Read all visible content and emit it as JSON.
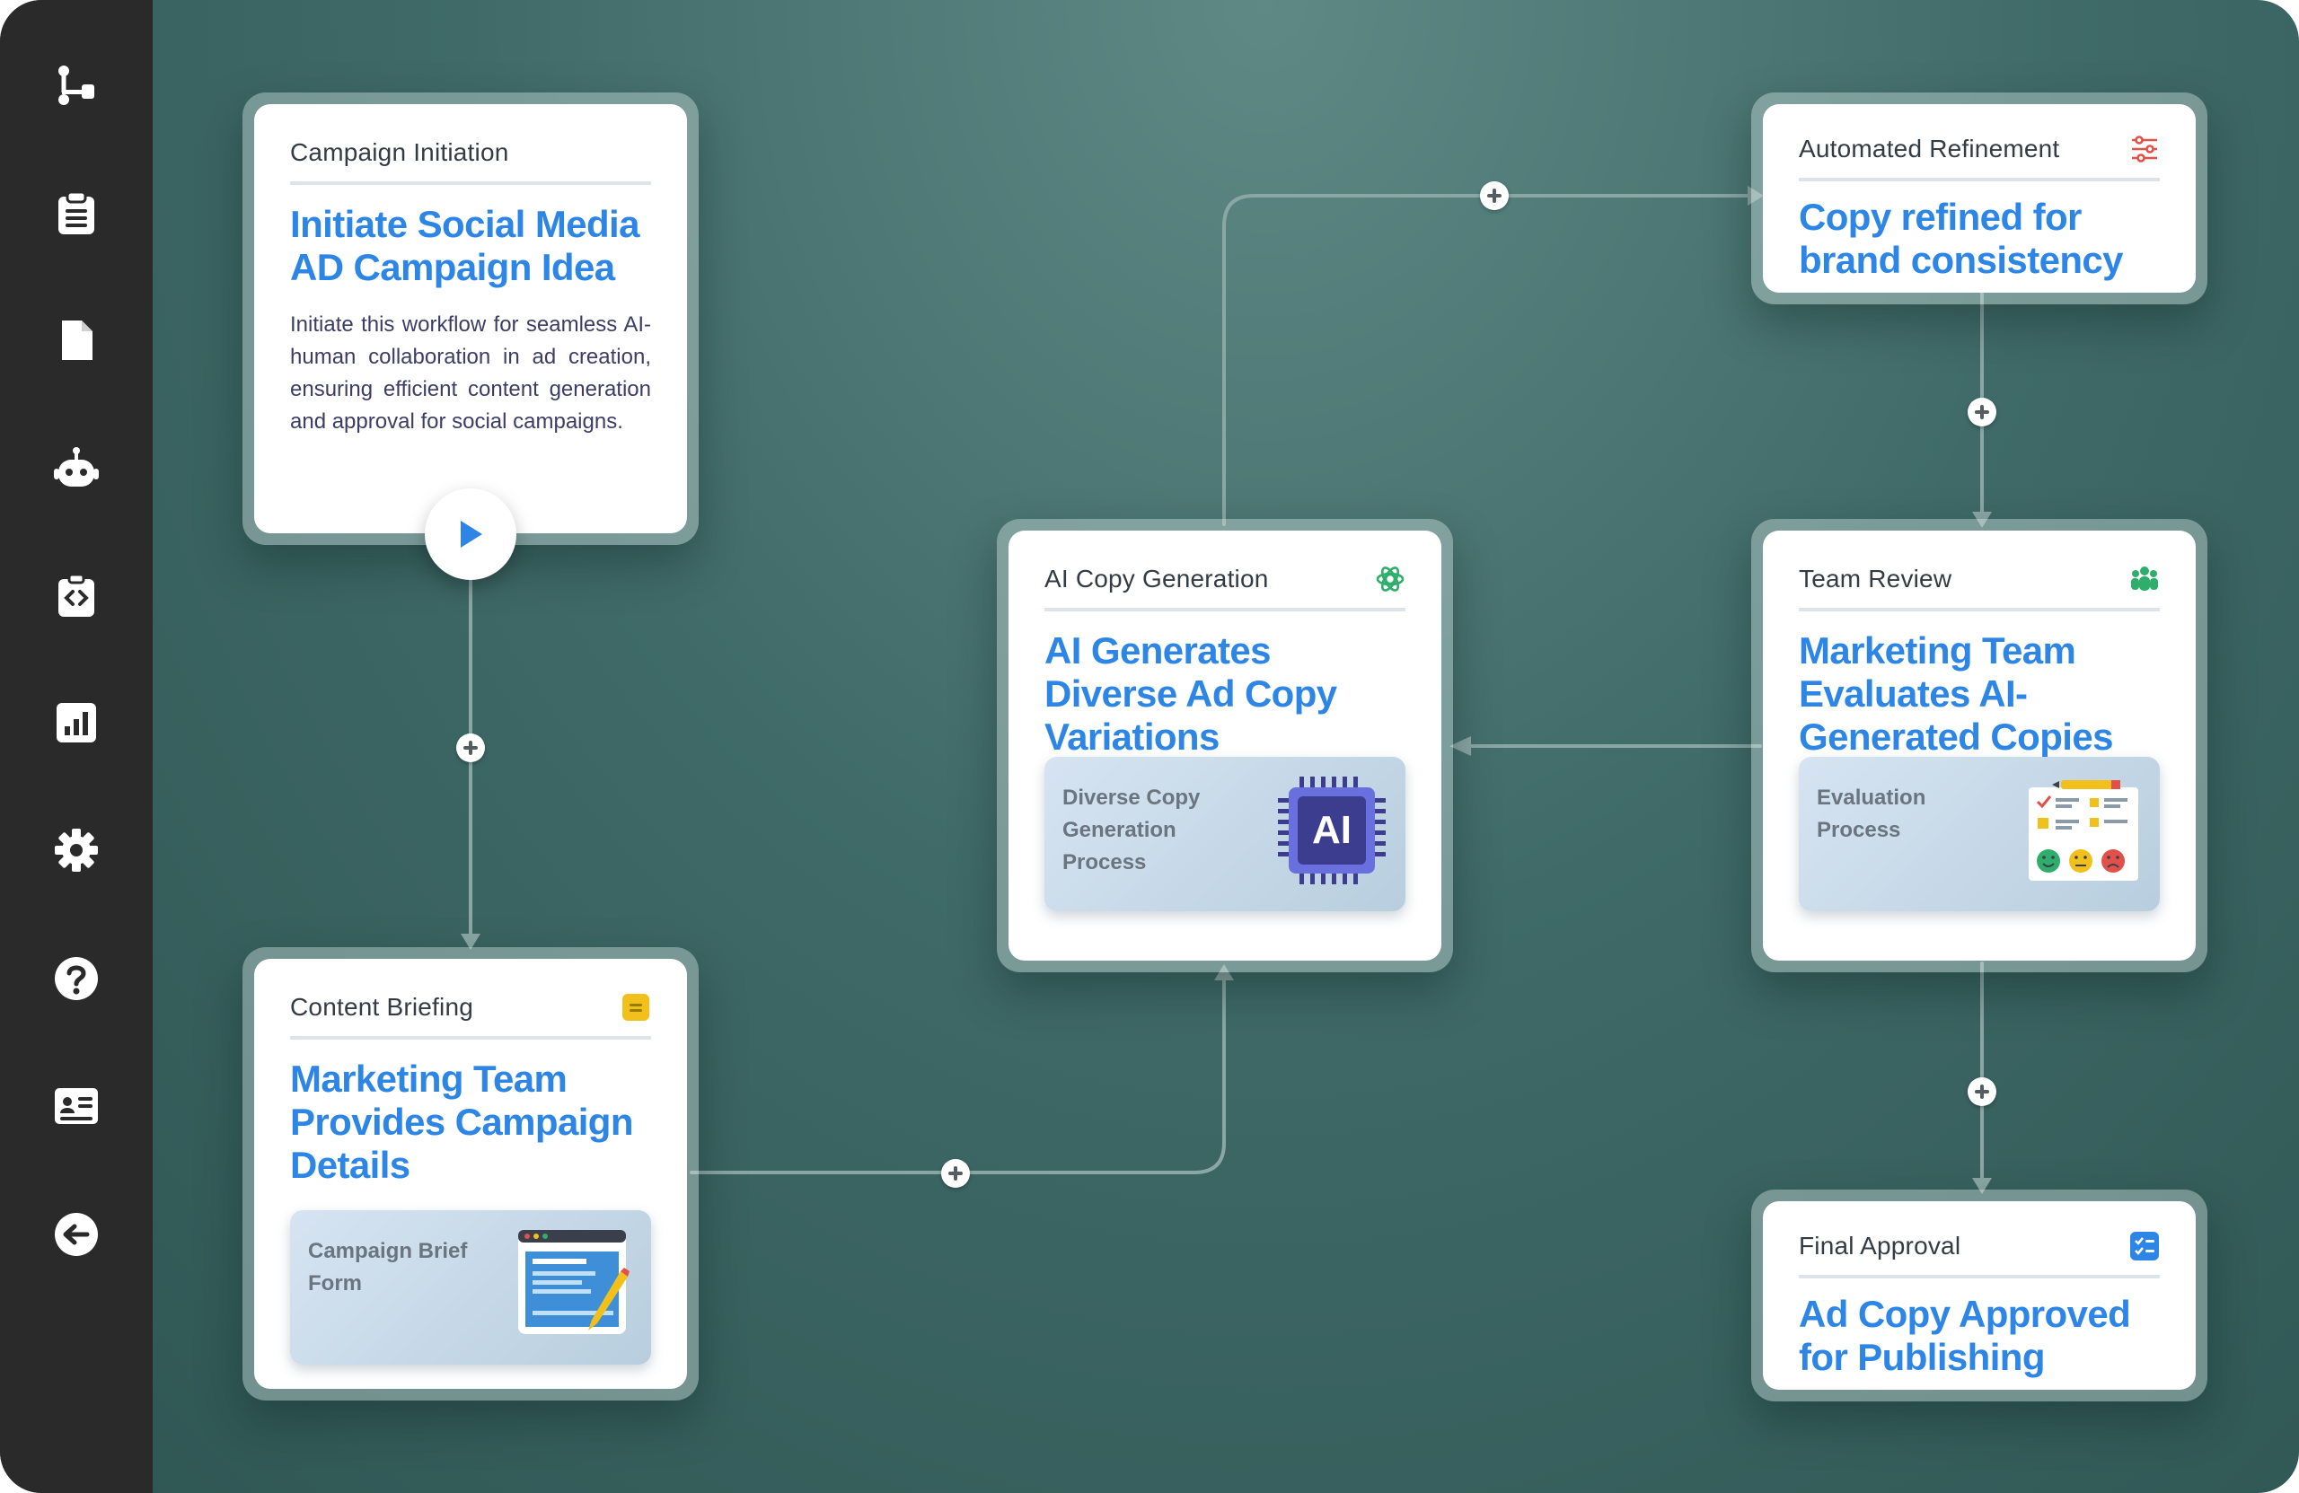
{
  "sidebar": {
    "icons": [
      {
        "name": "workflow-icon"
      },
      {
        "name": "clipboard-icon"
      },
      {
        "name": "document-icon"
      },
      {
        "name": "robot-icon"
      },
      {
        "name": "code-clipboard-icon"
      },
      {
        "name": "analytics-icon"
      },
      {
        "name": "settings-icon"
      },
      {
        "name": "help-icon"
      },
      {
        "name": "id-card-icon"
      },
      {
        "name": "back-arrow-icon"
      }
    ],
    "bg_color": "#2a2a2a"
  },
  "colors": {
    "title_blue": "#2d86e6",
    "accent_green": "#2fae6b",
    "accent_yellow": "#f2c01a",
    "accent_red": "#e2504a"
  },
  "cards": {
    "campaign_initiation": {
      "label": "Campaign Initiation",
      "title": "Initiate Social Media AD Campaign Idea",
      "description": "Initiate this workflow for seamless AI-human collaboration in ad creation, ensuring efficient content generation and approval for social campaigns."
    },
    "content_briefing": {
      "label": "Content Briefing",
      "title": "Marketing Team Provides Campaign Details",
      "inner_label": "Campaign Brief Form",
      "icon": "note-icon"
    },
    "ai_copy_generation": {
      "label": "AI Copy Generation",
      "title": "AI Generates Diverse Ad Copy Variations",
      "inner_label": "Diverse Copy Generation Process",
      "chip_text": "AI",
      "icon": "openai-icon"
    },
    "automated_refinement": {
      "label": "Automated Refinement",
      "title": "Copy refined for brand consistency",
      "icon": "sliders-icon"
    },
    "team_review": {
      "label": "Team Review",
      "title": "Marketing Team Evaluates AI-Generated Copies",
      "inner_label": "Evaluation Process",
      "icon": "team-icon"
    },
    "final_approval": {
      "label": "Final Approval",
      "title": "Ad Copy Approved for Publishing",
      "icon": "checklist-icon"
    }
  }
}
